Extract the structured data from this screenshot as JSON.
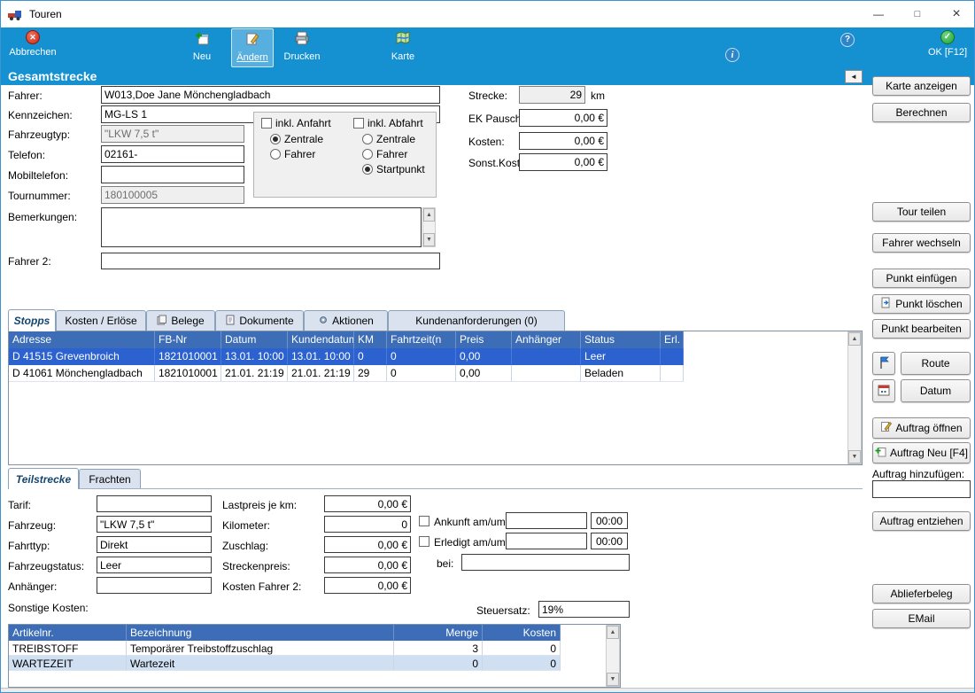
{
  "icons": {
    "minimize": "—",
    "maximize": "□",
    "close": "×",
    "x": "✕",
    "check": "✓",
    "info": "i",
    "help": "?",
    "left_arrow": "◄",
    "up_arrow": "▲",
    "down_arrow": "▼"
  },
  "window": {
    "title": "Touren"
  },
  "toolbar": {
    "abbrechen": "Abbrechen",
    "neu": "Neu",
    "aendern": "Ändern",
    "drucken": "Drucken",
    "karte": "Karte",
    "ok": "OK [F12]"
  },
  "section": {
    "title": "Gesamtstrecke"
  },
  "form": {
    "labels": {
      "fahrer": "Fahrer:",
      "kennzeichen": "Kennzeichen:",
      "fahrzeugtyp": "Fahrzeugtyp:",
      "telefon": "Telefon:",
      "mobiltelefon": "Mobiltelefon:",
      "tournummer": "Tournummer:",
      "bemerkungen": "Bemerkungen:",
      "fahrer2": "Fahrer 2:"
    },
    "values": {
      "fahrer": "W013,Doe Jane Mönchengladbach",
      "kennzeichen": "MG-LS 1",
      "fahrzeugtyp": "\"LKW 7,5 t\"",
      "telefon": "02161-",
      "mobiltelefon": "",
      "tournummer": "180100005",
      "bemerkungen": "",
      "fahrer2": ""
    },
    "options": {
      "inkl_anfahrt": "inkl. Anfahrt",
      "inkl_abfahrt": "inkl. Abfahrt",
      "zentrale1": "Zentrale",
      "fahrer1": "Fahrer",
      "zentrale2": "Zentrale",
      "fahrer2": "Fahrer",
      "startpunkt": "Startpunkt"
    },
    "totals": {
      "strecke_label": "Strecke:",
      "strecke": "29",
      "strecke_unit": "km",
      "ek_pauschal_label": "EK Pauschal:",
      "ek_pauschal": "0,00 €",
      "kosten_label": "Kosten:",
      "kosten": "0,00 €",
      "sonst_kosten_label": "Sonst.Kosten:",
      "sonst_kosten": "0,00 €"
    }
  },
  "side": {
    "karte_anzeigen": "Karte anzeigen",
    "berechnen": "Berechnen",
    "tour_teilen": "Tour teilen",
    "fahrer_wechseln": "Fahrer wechseln",
    "punkt_einfuegen": "Punkt einfügen",
    "punkt_loeschen": "Punkt löschen",
    "punkt_bearbeiten": "Punkt bearbeiten",
    "route": "Route",
    "datum": "Datum",
    "auftrag_oeffnen": "Auftrag öffnen",
    "auftrag_neu": "Auftrag Neu [F4]",
    "auftrag_hinzufuegen_label": "Auftrag hinzufügen:",
    "auftrag_hinzufuegen": "",
    "auftrag_entziehen": "Auftrag entziehen",
    "ablieferbeleg": "Ablieferbeleg",
    "email": "EMail"
  },
  "stops": {
    "tabs": [
      "Stopps",
      "Kosten / Erlöse",
      "Belege",
      "Dokumente",
      "Aktionen",
      "Kundenanforderungen (0)"
    ],
    "columns": [
      "Adresse",
      "FB-Nr",
      "Datum",
      "Kundendatum",
      "KM",
      "Fahrtzeit(n",
      "Preis",
      "Anhänger",
      "Status",
      "Erl."
    ],
    "rows": [
      [
        "D 41515 Grevenbroich",
        "1821010001",
        "13.01. 10:00",
        "13.01. 10:00",
        "0",
        "0",
        "0,00",
        "",
        "Leer",
        ""
      ],
      [
        "D 41061 Mönchengladbach",
        "1821010001",
        "21.01. 21:19",
        "21.01. 21:19",
        "29",
        "0",
        "0,00",
        "",
        "Beladen",
        ""
      ]
    ]
  },
  "detail": {
    "tabs": [
      "Teilstrecke",
      "Frachten"
    ],
    "labels": {
      "tarif": "Tarif:",
      "fahrzeug": "Fahrzeug:",
      "fahrttyp": "Fahrttyp:",
      "fahrzeugstatus": "Fahrzeugstatus:",
      "anhaenger": "Anhänger:",
      "sonstige_kosten": "Sonstige Kosten:",
      "lastpreis": "Lastpreis je km:",
      "kilometer": "Kilometer:",
      "zuschlag": "Zuschlag:",
      "streckenpreis": "Streckenpreis:",
      "kosten_fahrer2": "Kosten Fahrer 2:",
      "ankunft": "Ankunft am/um:",
      "erledigt": "Erledigt am/um:",
      "bei": "bei:",
      "steuersatz": "Steuersatz:"
    },
    "values": {
      "tarif": "",
      "fahrzeug": "\"LKW 7,5 t\"",
      "fahrttyp": "Direkt",
      "fahrzeugstatus": "Leer",
      "anhaenger": "",
      "lastpreis": "0,00 €",
      "kilometer": "0",
      "zuschlag": "0,00 €",
      "streckenpreis": "0,00 €",
      "kosten_fahrer2": "0,00 €",
      "ankunft_datum": "",
      "ankunft_zeit": "00:00",
      "erledigt_datum": "",
      "erledigt_zeit": "00:00",
      "bei": "",
      "steuersatz": "19%"
    }
  },
  "articles": {
    "columns": [
      "Artikelnr.",
      "Bezeichnung",
      "Menge",
      "Kosten"
    ],
    "rows": [
      [
        "TREIBSTOFF",
        "Temporärer Treibstoffzuschlag",
        "3",
        "0"
      ],
      [
        "WARTEZEIT",
        "Wartezeit",
        "0",
        "0"
      ]
    ]
  }
}
